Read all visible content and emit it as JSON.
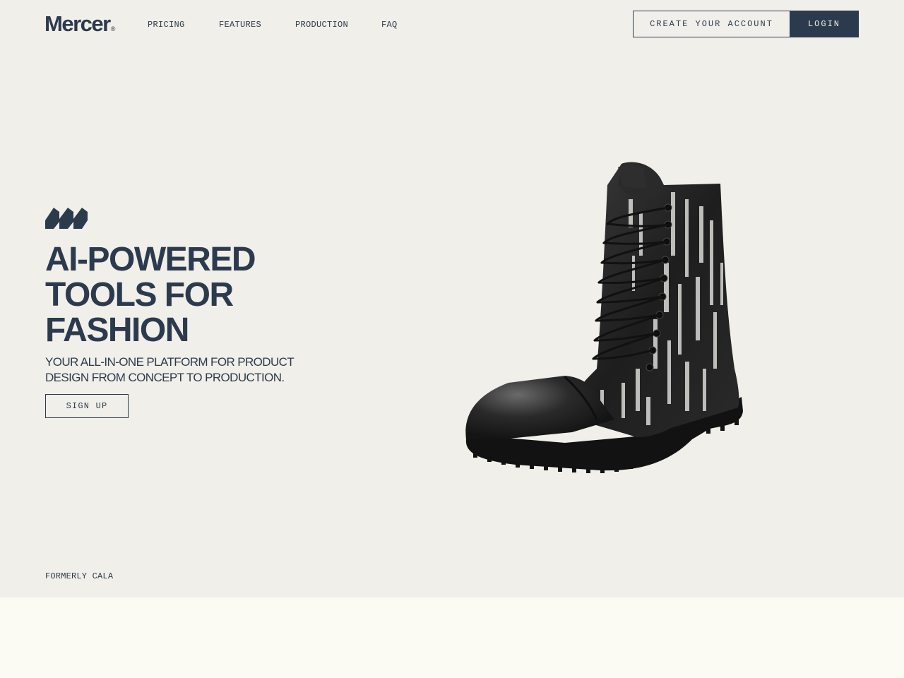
{
  "header": {
    "logo_text": "Mercer",
    "logo_mark": "®",
    "nav": [
      {
        "label": "PRICING"
      },
      {
        "label": "FEATURES"
      },
      {
        "label": "PRODUCTION"
      },
      {
        "label": "FAQ"
      }
    ],
    "create_account_label": "CREATE YOUR ACCOUNT",
    "login_label": "LOGIN"
  },
  "hero": {
    "headline_lines": [
      "AI-POWERED",
      "TOOLS FOR",
      "FASHION"
    ],
    "subheadline": "YOUR ALL-IN-ONE PLATFORM FOR PRODUCT DESIGN FROM CONCEPT TO PRODUCTION.",
    "signup_label": "SIGN UP",
    "image": "boot-product-image"
  },
  "footer_note": "FORMERLY CALA",
  "colors": {
    "primary": "#2c3a4d",
    "hero_background": "#f1efe9",
    "section_background": "#fbfaf3"
  }
}
